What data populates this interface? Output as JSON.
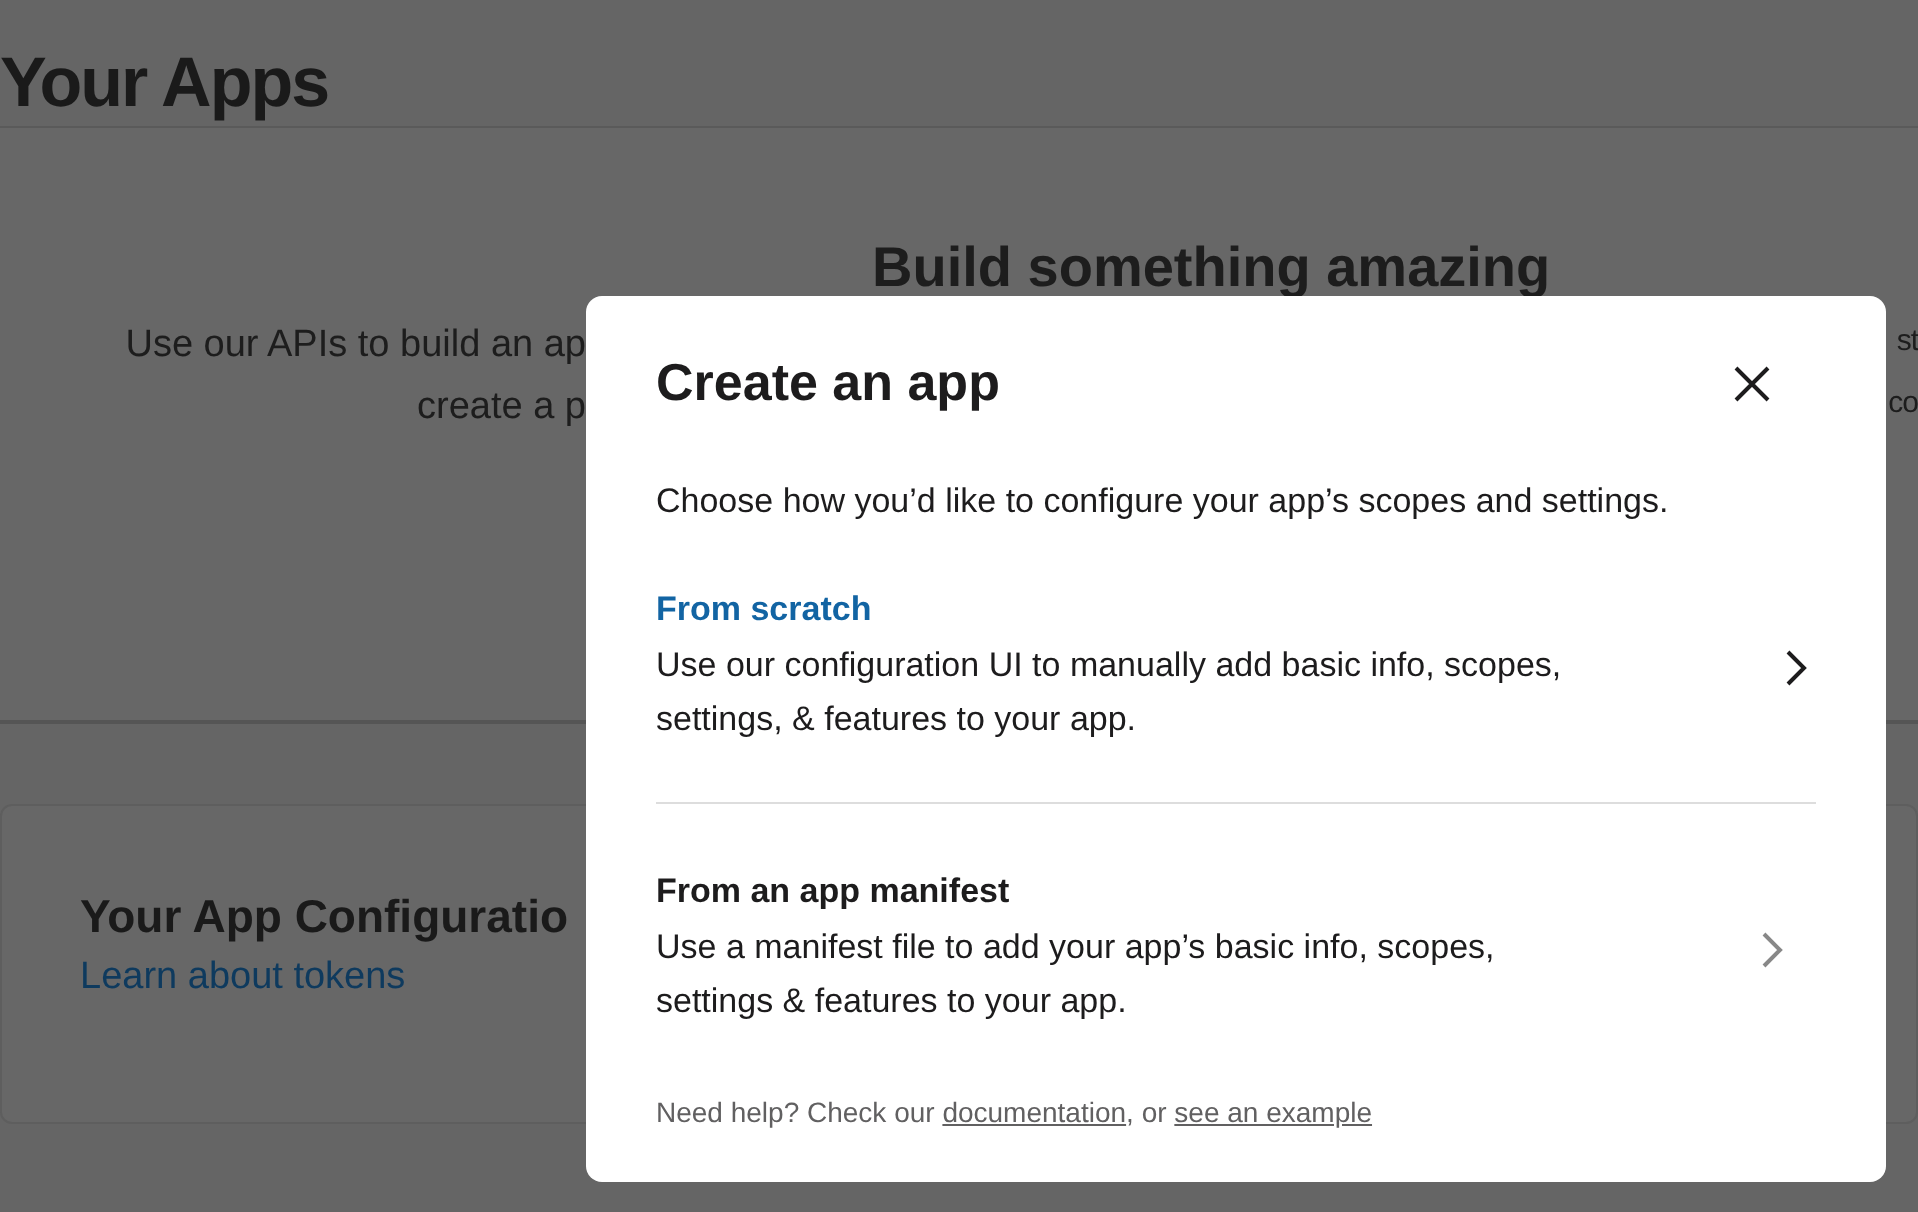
{
  "page": {
    "title": "Your Apps"
  },
  "hero": {
    "heading": "Build something amazing",
    "left_lines": [
      "Use our APIs to build an ap",
      "create a p"
    ],
    "right_lines": [
      "st",
      "co"
    ]
  },
  "config_card": {
    "title": "Your App Configuratio",
    "link": "Learn about tokens"
  },
  "modal": {
    "title": "Create an app",
    "description": "Choose how you’d like to configure your app’s scopes and settings.",
    "options": [
      {
        "title": "From scratch",
        "description": "Use our configuration UI to manually add basic info, scopes, settings, & features to your app.",
        "highlighted": true
      },
      {
        "title": "From an app manifest",
        "description": "Use a manifest file to add your app’s basic info, scopes, settings & features to your app.",
        "highlighted": false
      }
    ],
    "help": [
      {
        "kind": "text",
        "text": "Need help? Check our "
      },
      {
        "kind": "link",
        "text": "documentation"
      },
      {
        "kind": "text",
        "text": ", or "
      },
      {
        "kind": "link",
        "text": "see an example"
      }
    ]
  }
}
